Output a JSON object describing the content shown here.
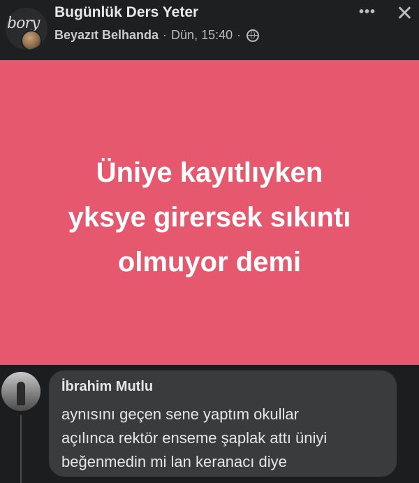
{
  "post": {
    "group_name": "Bugünlük Ders Yeter",
    "avatar_logo_text": "bory",
    "author": "Beyazıt Belhanda",
    "separator": "·",
    "timestamp": "Dün, 15:40",
    "privacy_icon": "globe-icon",
    "more_icon": "•••",
    "close_icon": "✕"
  },
  "text_card": {
    "background_color": "#e5586e",
    "lines": [
      "Üniye kayıtlıyken",
      "yksye girersek sıkıntı",
      "olmuyor demi"
    ]
  },
  "comment": {
    "name": "İbrahim Mutlu",
    "lines": [
      "aynısını geçen sene yaptım okullar",
      "açılınca rektör enseme şaplak attı üniyi",
      "beğenmedin mi lan keranacı diye"
    ]
  }
}
